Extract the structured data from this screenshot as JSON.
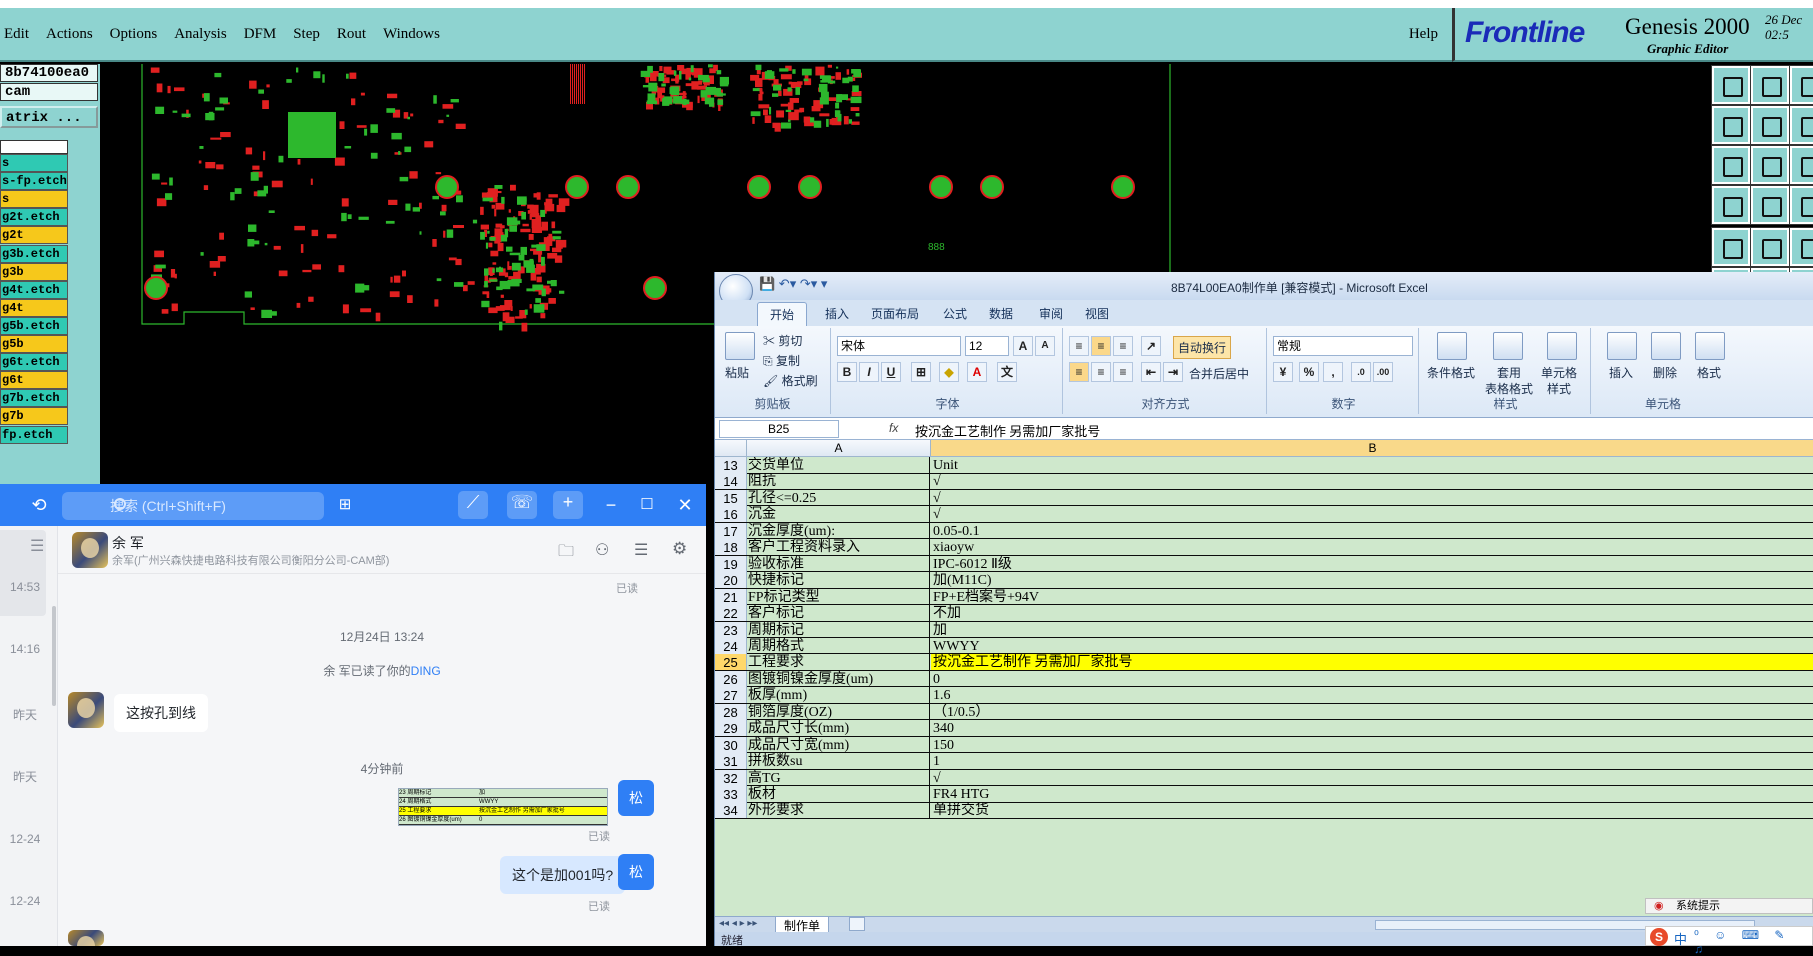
{
  "genesis": {
    "menu": [
      "Edit",
      "Actions",
      "Options",
      "Analysis",
      "DFM",
      "Step",
      "Rout",
      "Windows"
    ],
    "help": "Help",
    "brand": "Frontline",
    "product_title": "Genesis 2000",
    "product_subtitle": "Graphic Editor",
    "date_line1": "26 Dec",
    "date_line2": "02:5",
    "job_name": "8b74100ea0",
    "step_name": "cam",
    "matrix_button": "atrix ...",
    "layers": [
      {
        "name": "s",
        "color": "green"
      },
      {
        "name": "s-fp.etch",
        "color": "green"
      },
      {
        "name": "s",
        "color": "yellow"
      },
      {
        "name": "g2t.etch",
        "color": "green"
      },
      {
        "name": "g2t",
        "color": "yellow"
      },
      {
        "name": "g3b.etch",
        "color": "green"
      },
      {
        "name": "g3b",
        "color": "yellow"
      },
      {
        "name": "g4t.etch",
        "color": "green"
      },
      {
        "name": "g4t",
        "color": "yellow"
      },
      {
        "name": "g5b.etch",
        "color": "green"
      },
      {
        "name": "g5b",
        "color": "yellow"
      },
      {
        "name": "g6t.etch",
        "color": "green"
      },
      {
        "name": "g6t",
        "color": "yellow"
      },
      {
        "name": "g7b.etch",
        "color": "green"
      },
      {
        "name": "g7b",
        "color": "yellow"
      },
      {
        "name": "fp.etch",
        "color": "green"
      }
    ],
    "canvas_label": "888",
    "colors": {
      "panel": "#8ed3d0",
      "pad": "#2db82d",
      "trace": "#e02020",
      "layer_green": "#2fc9b3",
      "layer_yellow": "#f6c81b"
    }
  },
  "chat": {
    "search_placeholder": "搜索 (Ctrl+Shift+F)",
    "contact_name": "余 军",
    "contact_org": "余军(广州兴森快捷电路科技有限公司衡阳分公司-CAM部)",
    "sidebar_times": [
      "14:53",
      "14:16",
      "昨天",
      "昨天",
      "12-24",
      "12-24"
    ],
    "read_label": "已读",
    "date_divider": "12月24日 13:24",
    "ding_notice_prefix": "余 军已读了你的",
    "ding_notice_link": "DING",
    "msg_incoming": "这按孔到线",
    "time_divider2": "4分钟前",
    "msg_outgoing": "这个是加001吗?",
    "my_avatar_label": "松",
    "thumb_rows": [
      {
        "n": "23",
        "a": "周期标记",
        "b": "加"
      },
      {
        "n": "24",
        "a": "周期格式",
        "b": "WWYY"
      },
      {
        "n": "25",
        "a": "工程要求",
        "b": "按沉金工艺制作      另需加厂家批号"
      },
      {
        "n": "26",
        "a": "图镀铜镍金厚度(um)",
        "b": "0"
      }
    ]
  },
  "excel": {
    "window_title": "8B74L00EA0制作单 [兼容模式] - Microsoft Excel",
    "ribbon_tabs": [
      "开始",
      "插入",
      "页面布局",
      "公式",
      "数据",
      "审阅",
      "视图"
    ],
    "active_tab": "开始",
    "clipboard": {
      "paste": "粘贴",
      "cut": "剪切",
      "copy": "复制",
      "format_painter": "格式刷",
      "label": "剪贴板"
    },
    "font": {
      "name": "宋体",
      "size": "12",
      "label": "字体",
      "bold": "B",
      "italic": "I",
      "underline": "U"
    },
    "alignment": {
      "wrap": "自动换行",
      "merge": "合并后居中",
      "label": "对齐方式"
    },
    "number": {
      "format": "常规",
      "label": "数字",
      "percent": "%",
      "comma": ","
    },
    "styles": {
      "conditional": "条件格式",
      "table_style_1": "套用",
      "table_style_2": "表格格式",
      "cell_style_1": "单元格",
      "cell_style_2": "样式",
      "label": "样式"
    },
    "cells": {
      "insert": "插入",
      "delete": "删除",
      "format": "格式",
      "label": "单元格"
    },
    "name_box": "B25",
    "fx": "fx",
    "formula": "按沉金工艺制作      另需加厂家批号",
    "col_a": "A",
    "col_b": "B",
    "highlight_color": "#ffff00",
    "rows": [
      {
        "n": "13",
        "a": "交货单位",
        "b": "Unit"
      },
      {
        "n": "14",
        "a": "阻抗",
        "b": "√"
      },
      {
        "n": "15",
        "a": "孔径<=0.25",
        "b": "√"
      },
      {
        "n": "16",
        "a": "沉金",
        "b": "√"
      },
      {
        "n": "17",
        "a": "沉金厚度(um):",
        "b": "0.05-0.1"
      },
      {
        "n": "18",
        "a": "客户工程资料录入",
        "b": "xiaoyw"
      },
      {
        "n": "19",
        "a": "验收标准",
        "b": "IPC-6012 Ⅱ级"
      },
      {
        "n": "20",
        "a": "快捷标记",
        "b": "加(M11C)"
      },
      {
        "n": "21",
        "a": "FP标记类型",
        "b": "FP+E档案号+94V"
      },
      {
        "n": "22",
        "a": "客户标记",
        "b": "不加"
      },
      {
        "n": "23",
        "a": "周期标记",
        "b": "加"
      },
      {
        "n": "24",
        "a": "周期格式",
        "b": "WWYY"
      },
      {
        "n": "25",
        "a": "工程要求",
        "b": "按沉金工艺制作      另需加厂家批号",
        "highlight": true
      },
      {
        "n": "26",
        "a": "图镀铜镍金厚度(um)",
        "b": "0"
      },
      {
        "n": "27",
        "a": "板厚(mm)",
        "b": "1.6"
      },
      {
        "n": "28",
        "a": "铜箔厚度(OZ)",
        "b": "（1/0.5）"
      },
      {
        "n": "29",
        "a": "成品尺寸长(mm)",
        "b": "340"
      },
      {
        "n": "30",
        "a": "成品尺寸宽(mm)",
        "b": "150"
      },
      {
        "n": "31",
        "a": "拼板数su",
        "b": "1"
      },
      {
        "n": "32",
        "a": "高TG",
        "b": "√"
      },
      {
        "n": "33",
        "a": "板材",
        "b": "FR4 HTG"
      },
      {
        "n": "34",
        "a": "外形要求",
        "b": "单拼交货"
      }
    ],
    "sheet_tab": "制作单",
    "status": "就绪",
    "notice": "系统提示",
    "ime": "中"
  }
}
